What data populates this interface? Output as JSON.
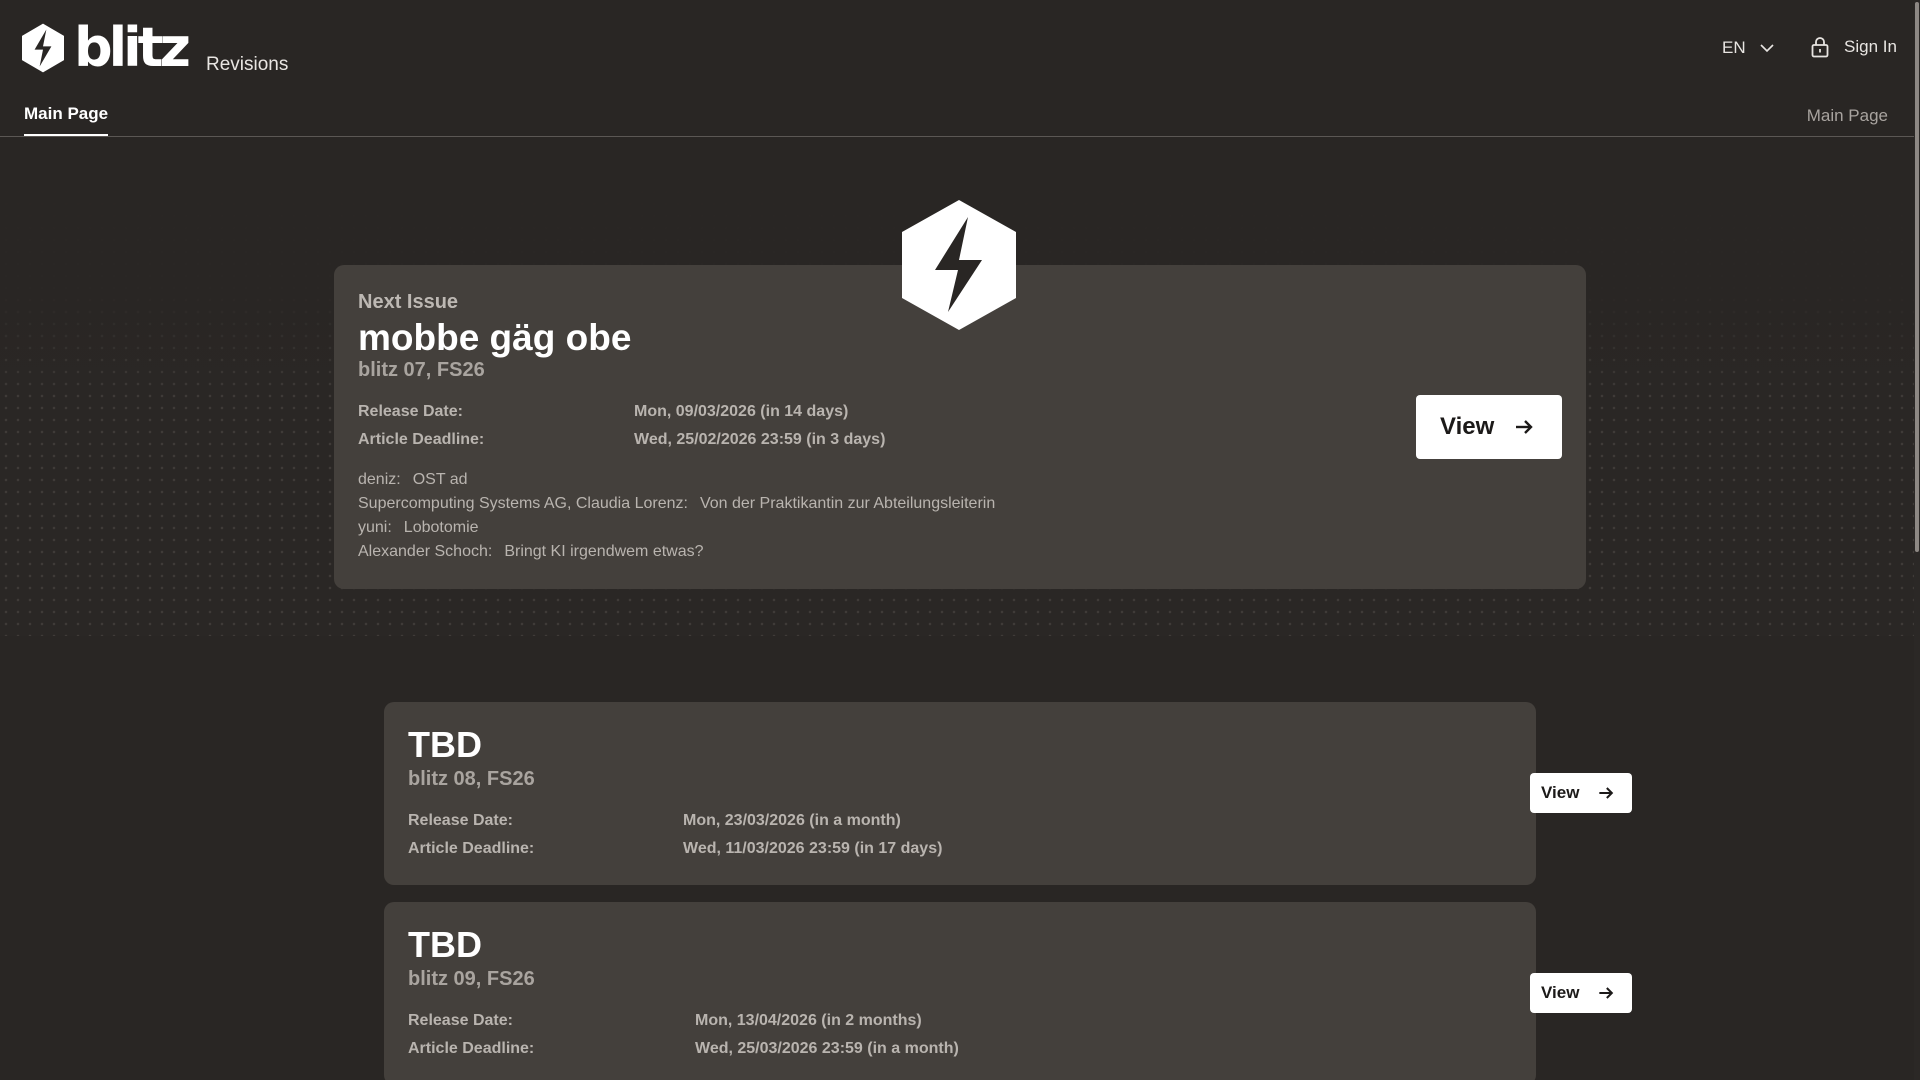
{
  "header": {
    "logo_text": "blitz",
    "nav_revisions": "Revisions",
    "language": "EN",
    "sign_in": "Sign In",
    "tab_main": "Main Page",
    "breadcrumb": "Main Page"
  },
  "next_issue": {
    "kicker": "Next Issue",
    "title": "mobbe gäg obe",
    "subtitle": "blitz 07, FS26",
    "release_label": "Release Date:",
    "release_value": "Mon, 09/03/2026 (in 14 days)",
    "deadline_label": "Article Deadline:",
    "deadline_value": "Wed, 25/02/2026 23:59 (in 3 days)",
    "view_label": "View",
    "contributions": [
      {
        "author": "deniz:",
        "title": "OST ad"
      },
      {
        "author": "Supercomputing Systems AG, Claudia Lorenz:",
        "title": "Von der Praktikantin zur Abteilungsleiterin"
      },
      {
        "author": "yuni:",
        "title": "Lobotomie"
      },
      {
        "author": "Alexander Schoch:",
        "title": "Bringt KI irgendwem etwas?"
      }
    ]
  },
  "issues": [
    {
      "title": "TBD",
      "subtitle": "blitz 08, FS26",
      "release_label": "Release Date:",
      "release_value": "Mon, 23/03/2026 (in a month)",
      "deadline_label": "Article Deadline:",
      "deadline_value": "Wed, 11/03/2026 23:59 (in 17 days)",
      "view_label": "View"
    },
    {
      "title": "TBD",
      "subtitle": "blitz 09, FS26",
      "release_label": "Release Date:",
      "release_value": "Mon, 13/04/2026 (in 2 months)",
      "deadline_label": "Article Deadline:",
      "deadline_value": "Wed, 25/03/2026 23:59 (in a month)",
      "view_label": "View"
    }
  ],
  "icons": {
    "logo": "blitz-logo-icon",
    "language": "chevron-down-icon",
    "sign_in": "lock-icon",
    "view": "arrow-right-icon"
  },
  "colors": {
    "background": "#292624",
    "card": "#44403c",
    "button": "#ffffff"
  }
}
